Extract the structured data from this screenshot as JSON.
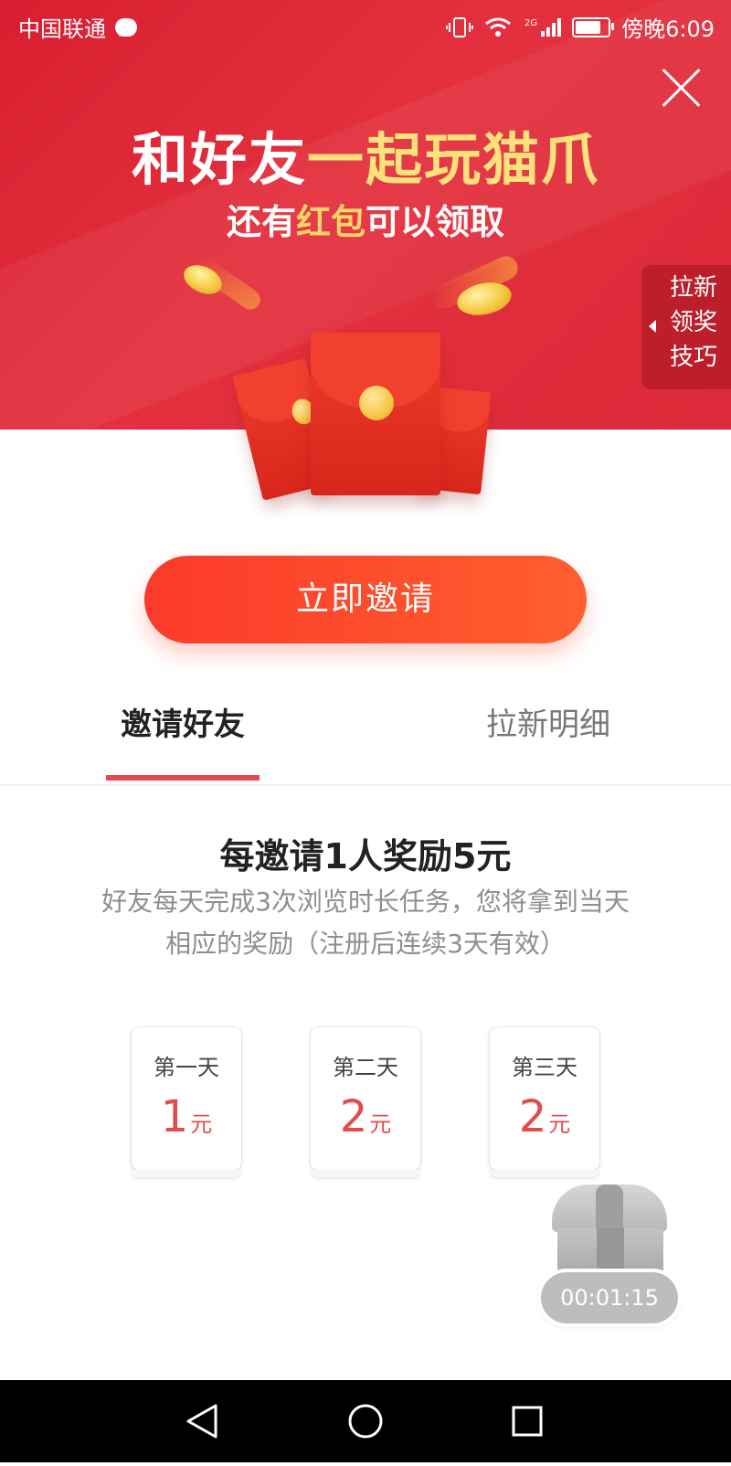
{
  "status_bar": {
    "carrier": "中国联通",
    "network": "2G",
    "time": "傍晚6:09",
    "battery_level": 0.8
  },
  "hero": {
    "headline_white": "和好友",
    "headline_yellow": "一起玩猫爪",
    "subline_prefix": "还有",
    "subline_highlight": "红包",
    "subline_suffix": "可以领取",
    "tips_tab": [
      "拉新",
      "领奖",
      "技巧"
    ]
  },
  "invite_button": {
    "label": "立即邀请"
  },
  "tabs": {
    "active": "邀请好友",
    "inactive": "拉新明细"
  },
  "reward": {
    "title": "每邀请1人奖励5元",
    "desc_line1": "好友每天完成3次浏览时长任务，您将拿到当天",
    "desc_line2": "相应的奖励（注册后连续3天有效）",
    "days": [
      {
        "label": "第一天",
        "amount": "1",
        "unit": "元"
      },
      {
        "label": "第二天",
        "amount": "2",
        "unit": "元"
      },
      {
        "label": "第三天",
        "amount": "2",
        "unit": "元"
      }
    ]
  },
  "timer": {
    "value": "00:01:15"
  },
  "colors": {
    "brand_red": "#e4303e",
    "button_orange": "#ff5f2e",
    "accent_yellow": "#fde17a",
    "amount_red": "#e24c4a"
  },
  "icons": [
    "chat-bubble-icon",
    "vibrate-icon",
    "wifi-icon",
    "signal-icon",
    "battery-icon",
    "close-icon",
    "chevron-left-icon",
    "coin-icon",
    "red-envelope-icon",
    "treasure-chest-icon",
    "back-icon",
    "home-icon",
    "recent-apps-icon"
  ]
}
